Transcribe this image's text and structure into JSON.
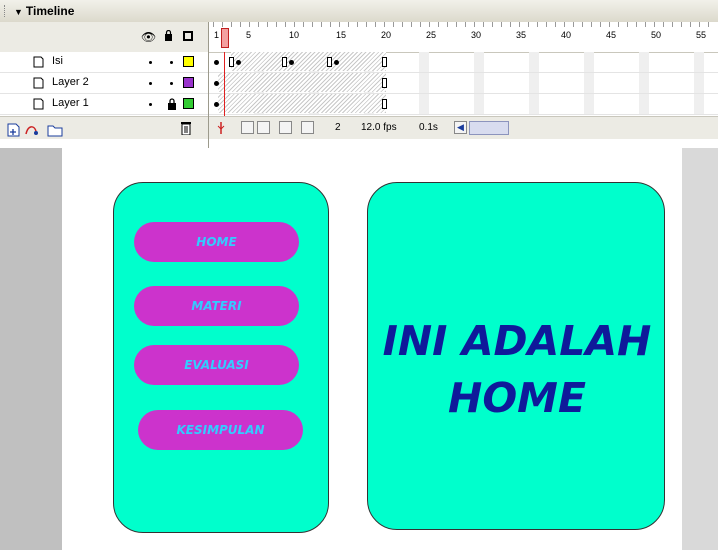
{
  "timeline": {
    "title": "Timeline",
    "layers": [
      {
        "name": "Isi",
        "color": "#ffff00",
        "locked": false
      },
      {
        "name": "Layer 2",
        "color": "#9933cc",
        "locked": false
      },
      {
        "name": "Layer 1",
        "color": "#33cc33",
        "locked": true
      }
    ],
    "ruler_labels": [
      "1",
      "5",
      "10",
      "15",
      "20",
      "25",
      "30",
      "35",
      "40",
      "45",
      "50",
      "55"
    ],
    "footer": {
      "current_frame": "2",
      "fps": "12.0 fps",
      "elapsed": "0.1s"
    }
  },
  "stage": {
    "panel_color": "#00ffcc",
    "button_color": "#cc33cc",
    "buttons": [
      "HOME",
      "MATERI",
      "EVALUASI",
      "KESIMPULAN"
    ],
    "headline_line1": "INI ADALAH",
    "headline_line2": "HOME"
  },
  "icons": [
    "eye-icon",
    "lock-icon",
    "outline-icon",
    "layer-icon",
    "trash-icon",
    "insert-layer-icon",
    "motion-guide-icon",
    "folder-icon",
    "onion-skin-icon",
    "edit-multiple-frames-icon"
  ]
}
